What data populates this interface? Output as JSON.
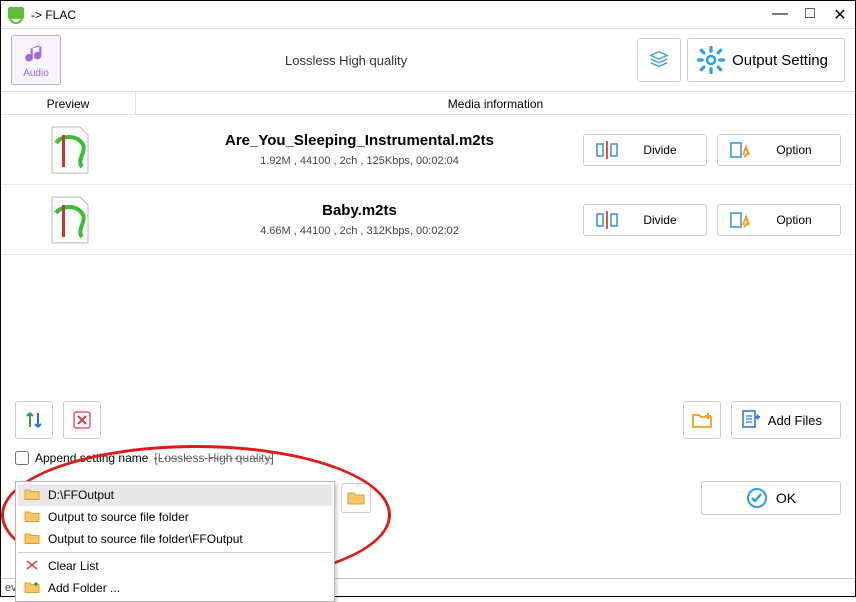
{
  "window": {
    "title": " -> FLAC"
  },
  "toolbar": {
    "format_label": "Audio",
    "quality": "Lossless High quality",
    "output_setting": "Output Setting"
  },
  "headers": {
    "preview": "Preview",
    "media": "Media information"
  },
  "rows": [
    {
      "filename": "Are_You_Sleeping_Instrumental.m2ts",
      "meta": "1.92M , 44100 , 2ch , 125Kbps, 00:02:04",
      "divide": "Divide",
      "option": "Option"
    },
    {
      "filename": "Baby.m2ts",
      "meta": "4.66M , 44100 , 2ch , 312Kbps, 00:02:02",
      "divide": "Divide",
      "option": "Option"
    }
  ],
  "bottom": {
    "add_files": "Add Files",
    "append_label": "Append setting name",
    "append_suffix": "[Lossless High quality]",
    "path_value": "D:\\FFOutput",
    "ok": "OK"
  },
  "dropdown": {
    "items": [
      "D:\\FFOutput",
      "Output to source file folder",
      "Output to source file folder\\FFOutput"
    ],
    "clear": "Clear List",
    "add_folder": "Add Folder ..."
  },
  "statusbar": "evice\\DVD\\CD\\ISO"
}
